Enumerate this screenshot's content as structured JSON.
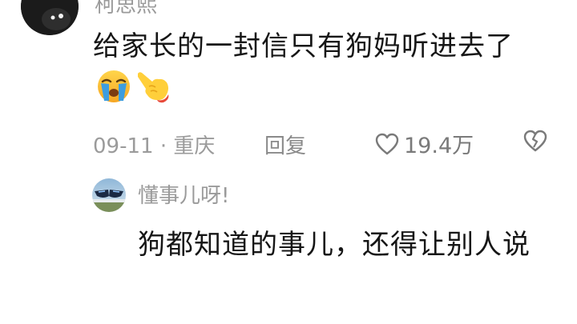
{
  "comment": {
    "username": "柯思熙",
    "text": "给家长的一封信只有狗妈听进去了",
    "emojis": [
      "loudly-crying-face-icon",
      "pointing-hand-icon"
    ],
    "date_location": "09-11 · 重庆",
    "reply_label": "回复",
    "like_count": "19.4万"
  },
  "reply": {
    "username": "懂事儿呀!",
    "text": "狗都知道的事儿，还得让别人说"
  },
  "colors": {
    "text": "#161616",
    "meta": "#9b9b9b",
    "background": "#ffffff"
  }
}
